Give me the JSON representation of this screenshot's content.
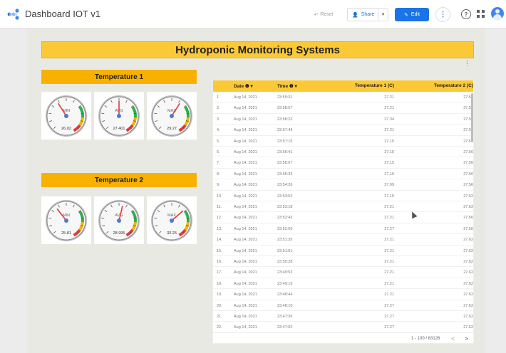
{
  "app": {
    "title": "Dashboard IOT v1"
  },
  "toolbar": {
    "reset_label": "Reset",
    "share_label": "Share",
    "edit_label": "Edit",
    "more_icon": "more-vert-icon",
    "help_icon": "help-icon",
    "apps_icon": "apps-grid-icon",
    "avatar_icon": "account-avatar-icon",
    "accent": "#1a73e8"
  },
  "report": {
    "title": "Hydroponic Monitoring Systems",
    "accent": "#fcc936",
    "section_color": "#f9b100",
    "sections": [
      {
        "title": "Temperature 1",
        "gauges": [
          {
            "label": "MIN",
            "value": "26.02",
            "level": 0.38
          },
          {
            "label": "AVG",
            "value": "27.401",
            "level": 0.5
          },
          {
            "label": "MAX",
            "value": "29.27",
            "level": 0.62
          }
        ]
      },
      {
        "title": "Temperature 2",
        "gauges": [
          {
            "label": "MIN",
            "value": "25.81",
            "level": 0.36
          },
          {
            "label": "AVG",
            "value": "28.995",
            "level": 0.55
          },
          {
            "label": "MAX",
            "value": "33.25",
            "level": 0.68
          }
        ]
      }
    ]
  },
  "table": {
    "columns": [
      "Date",
      "Time",
      "Temperature 1 (C)",
      "Temperature 2 (C)"
    ],
    "sort_icon": "sort-desc-icon",
    "rows": [
      [
        "1.",
        "Aug 14, 2021",
        "23:59:31",
        "27.21",
        "27.56"
      ],
      [
        "2.",
        "Aug 14, 2021",
        "23:58:57",
        "27.21",
        "27.56"
      ],
      [
        "3.",
        "Aug 14, 2021",
        "23:58:23",
        "27.34",
        "27.56"
      ],
      [
        "4.",
        "Aug 14, 2021",
        "23:57:49",
        "27.21",
        "27.56"
      ],
      [
        "5.",
        "Aug 14, 2021",
        "23:57:15",
        "27.15",
        "27.56"
      ],
      [
        "6.",
        "Aug 14, 2021",
        "23:56:41",
        "27.15",
        "27.56"
      ],
      [
        "7.",
        "Aug 14, 2021",
        "23:56:07",
        "27.15",
        "27.56"
      ],
      [
        "8.",
        "Aug 14, 2021",
        "23:55:33",
        "27.15",
        "27.56"
      ],
      [
        "9.",
        "Aug 14, 2021",
        "23:54:26",
        "27.09",
        "27.56"
      ],
      [
        "10.",
        "Aug 14, 2021",
        "23:53:52",
        "27.15",
        "27.62"
      ],
      [
        "11.",
        "Aug 14, 2021",
        "23:53:18",
        "27.21",
        "27.62"
      ],
      [
        "12.",
        "Aug 14, 2021",
        "23:52:43",
        "27.21",
        "27.56"
      ],
      [
        "13.",
        "Aug 14, 2021",
        "23:52:09",
        "27.27",
        "27.56"
      ],
      [
        "14.",
        "Aug 14, 2021",
        "23:51:35",
        "27.21",
        "27.62"
      ],
      [
        "15.",
        "Aug 14, 2021",
        "23:51:01",
        "27.21",
        "27.62"
      ],
      [
        "16.",
        "Aug 14, 2021",
        "23:50:28",
        "27.21",
        "27.62"
      ],
      [
        "17.",
        "Aug 14, 2021",
        "23:49:53",
        "27.21",
        "27.62"
      ],
      [
        "18.",
        "Aug 14, 2021",
        "23:49:19",
        "27.21",
        "27.62"
      ],
      [
        "19.",
        "Aug 14, 2021",
        "23:48:44",
        "27.21",
        "27.62"
      ],
      [
        "20.",
        "Aug 14, 2021",
        "23:48:10",
        "27.27",
        "27.62"
      ],
      [
        "21.",
        "Aug 14, 2021",
        "23:47:36",
        "27.27",
        "27.62"
      ],
      [
        "22.",
        "Aug 14, 2021",
        "23:47:02",
        "27.27",
        "27.62"
      ]
    ],
    "pager": "1 - 100 / 63126"
  }
}
